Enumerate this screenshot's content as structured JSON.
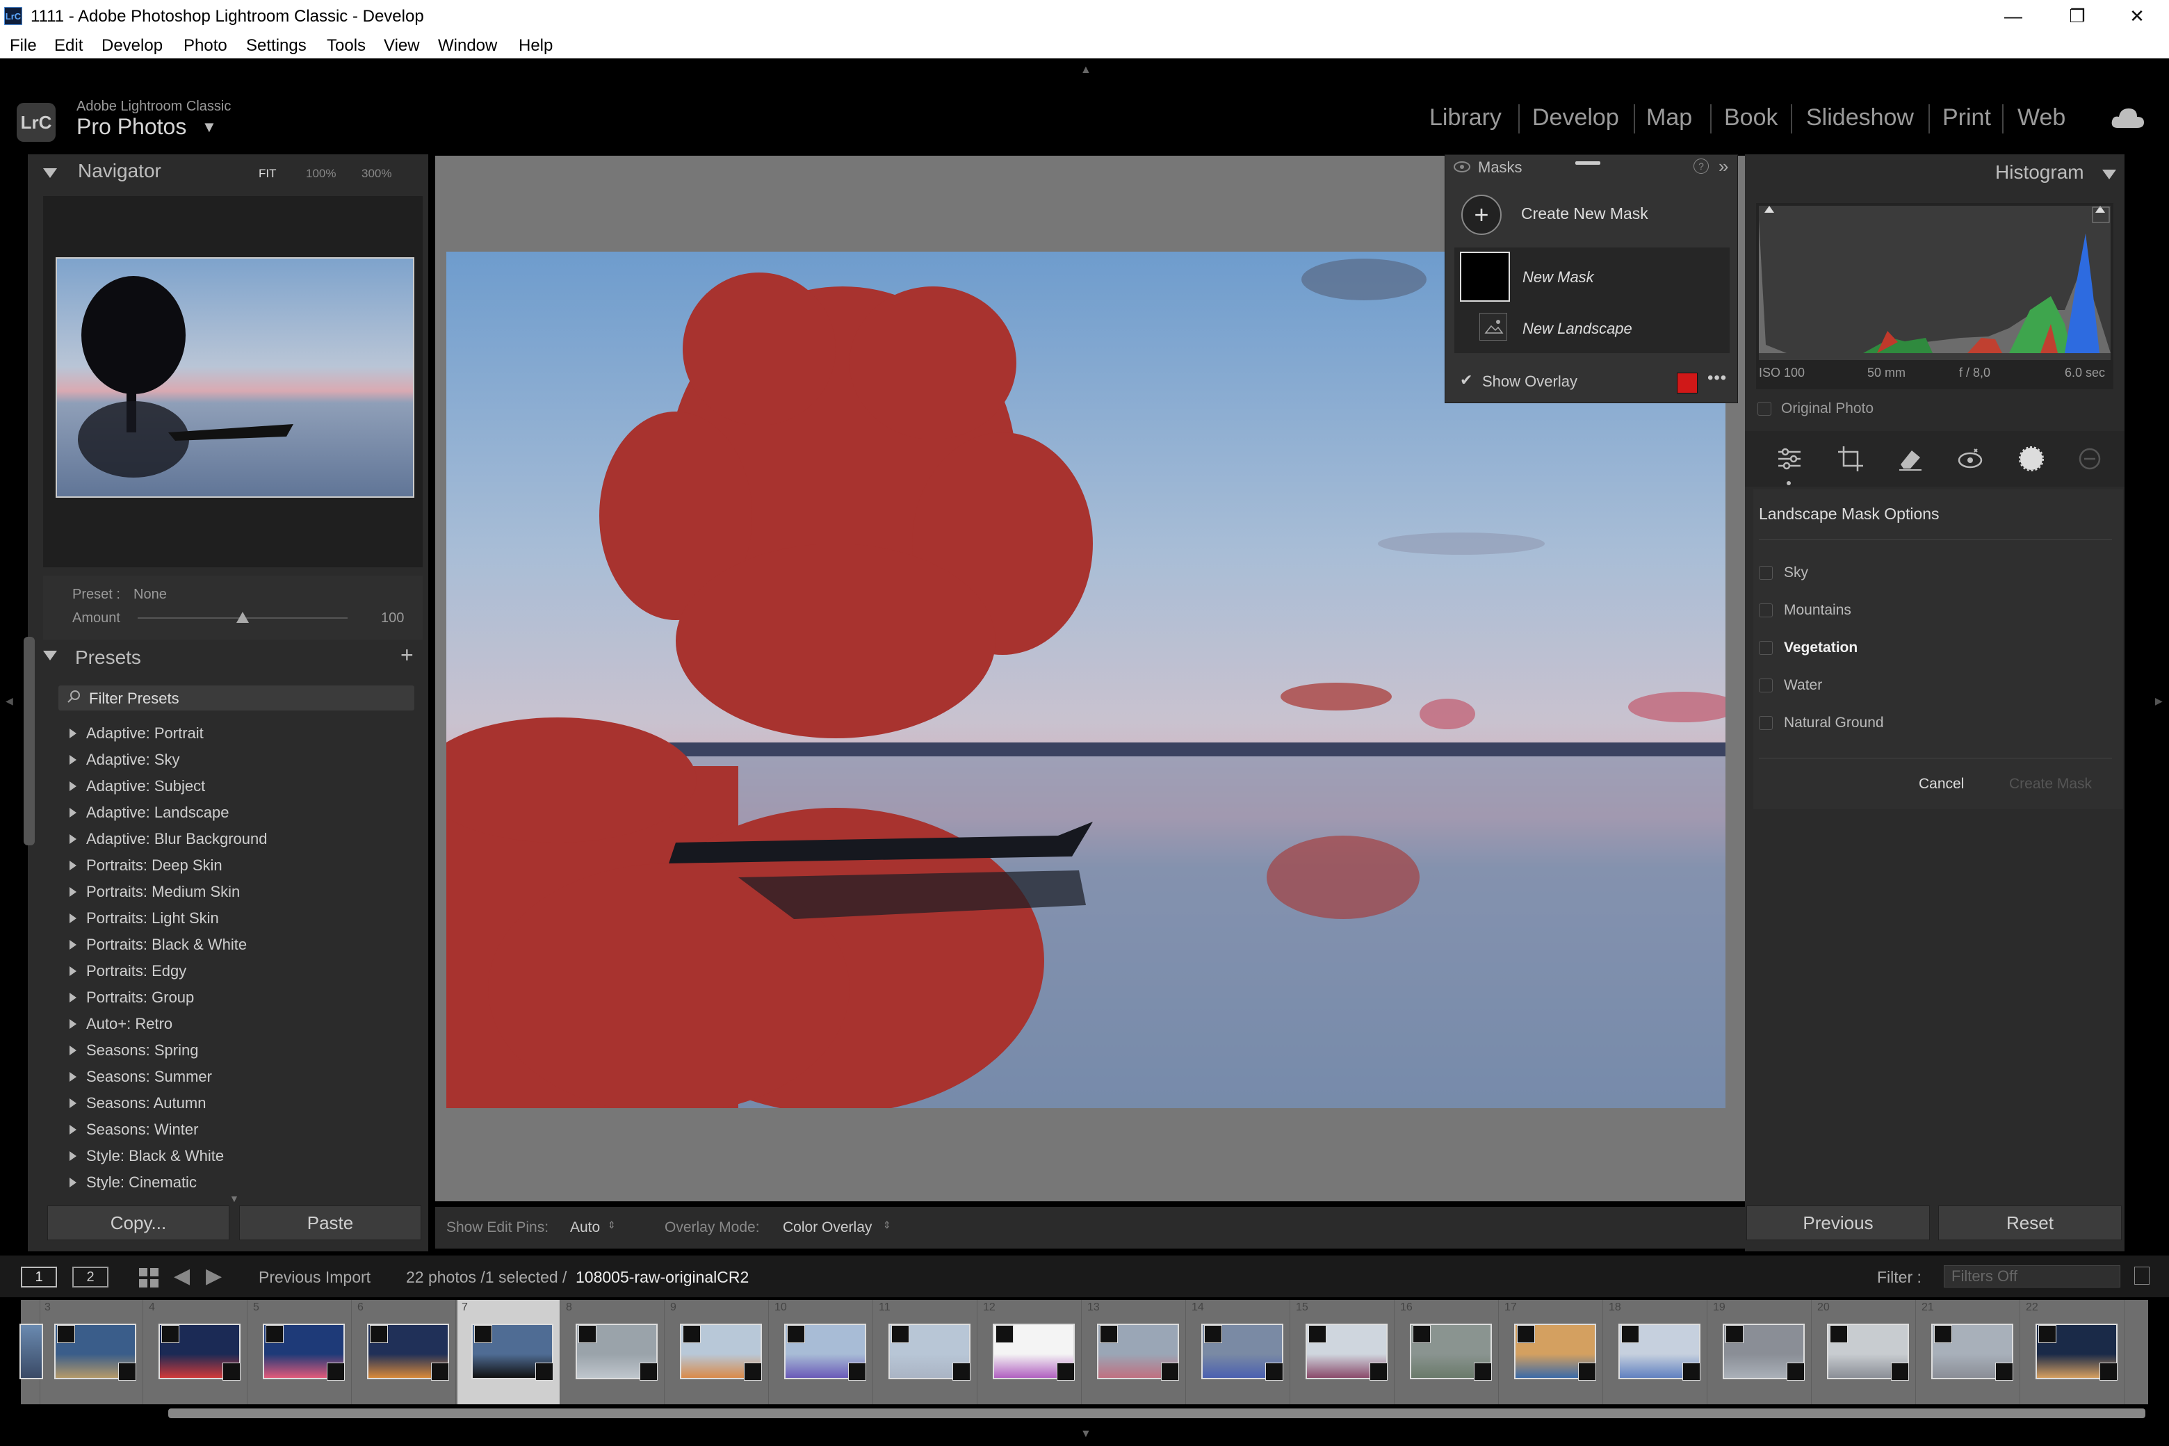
{
  "window": {
    "title": "1111 - Adobe Photoshop Lightroom Classic - Develop",
    "app_logo": "LrC",
    "controls": [
      "minimize",
      "maximize",
      "close"
    ]
  },
  "menu": [
    "File",
    "Edit",
    "Develop",
    "Photo",
    "Settings",
    "Tools",
    "View",
    "Window",
    "Help"
  ],
  "identity": {
    "badge": "LrC",
    "line1": "Adobe Lightroom Classic",
    "catalog": "Pro Photos"
  },
  "modules": [
    "Library",
    "Develop",
    "Map",
    "Book",
    "Slideshow",
    "Print",
    "Web"
  ],
  "active_module": "Develop",
  "navigator": {
    "title": "Navigator",
    "zoom_options": [
      "FIT",
      "100%",
      "300%"
    ]
  },
  "preset_amount": {
    "preset_label": "Preset :",
    "preset_value": "None",
    "amount_label": "Amount",
    "amount_value": "100",
    "amount_fraction": 0.5
  },
  "presets": {
    "title": "Presets",
    "filter_placeholder": "Filter Presets",
    "items": [
      "Adaptive: Portrait",
      "Adaptive: Sky",
      "Adaptive: Subject",
      "Adaptive: Landscape",
      "Adaptive: Blur Background",
      "Portraits: Deep Skin",
      "Portraits: Medium Skin",
      "Portraits: Light Skin",
      "Portraits: Black & White",
      "Portraits: Edgy",
      "Portraits: Group",
      "Auto+: Retro",
      "Seasons: Spring",
      "Seasons: Summer",
      "Seasons: Autumn",
      "Seasons: Winter",
      "Style: Black & White",
      "Style: Cinematic"
    ]
  },
  "left_buttons": {
    "copy": "Copy...",
    "paste": "Paste"
  },
  "toolbar": {
    "edit_pins_label": "Show Edit Pins:",
    "edit_pins_value": "Auto",
    "overlay_mode_label": "Overlay Mode:",
    "overlay_mode_value": "Color Overlay"
  },
  "masks_panel": {
    "title": "Masks",
    "create": "Create New Mask",
    "mask_name": "New Mask",
    "component": "New Landscape",
    "show_overlay": "Show Overlay",
    "overlay_color": "#d01818"
  },
  "histogram": {
    "title": "Histogram",
    "iso": "ISO 100",
    "focal": "50 mm",
    "aperture": "f / 8,0",
    "shutter": "6.0 sec",
    "original_photo": "Original Photo"
  },
  "landscape_options": {
    "title": "Landscape Mask Options",
    "items": [
      "Sky",
      "Mountains",
      "Vegetation",
      "Water",
      "Natural Ground"
    ],
    "selected": "Vegetation",
    "cancel": "Cancel",
    "create": "Create Mask"
  },
  "right_buttons": {
    "previous": "Previous",
    "reset": "Reset"
  },
  "filmbar": {
    "view1": "1",
    "view2": "2",
    "source": "Previous Import",
    "count": "22 photos /1 selected /",
    "filename": "108005-raw-originalCR2",
    "filter_label": "Filter :",
    "filter_value": "Filters Off"
  },
  "filmstrip": {
    "numbers": [
      "3",
      "4",
      "5",
      "6",
      "7",
      "8",
      "9",
      "10",
      "11",
      "12",
      "13",
      "14",
      "15",
      "16",
      "17",
      "18",
      "19",
      "20",
      "21",
      "22"
    ],
    "selected_index": 4
  }
}
